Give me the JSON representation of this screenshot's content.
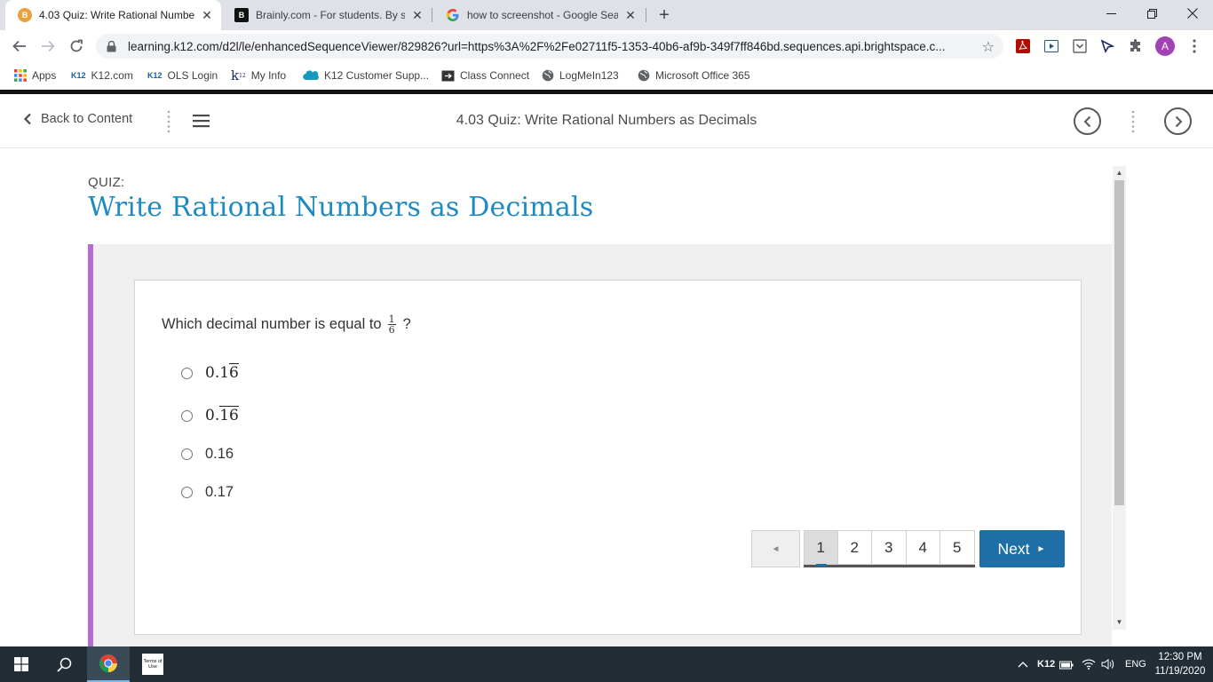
{
  "browser": {
    "tabs": [
      {
        "title": "4.03 Quiz: Write Rational Numbe",
        "favicon": "brightspace-icon",
        "active": true
      },
      {
        "title": "Brainly.com - For students. By stu",
        "favicon": "brainly-icon",
        "active": false
      },
      {
        "title": "how to screenshot - Google Sear",
        "favicon": "google-icon",
        "active": false
      }
    ],
    "url": "learning.k12.com/d2l/le/enhancedSequenceViewer/829826?url=https%3A%2F%2Fe02711f5-1353-40b6-af9b-349f7ff846bd.sequences.api.brightspace.c...",
    "profile_initial": "A",
    "bookmarks": [
      {
        "label": "Apps"
      },
      {
        "label": "K12.com"
      },
      {
        "label": "OLS Login"
      },
      {
        "label": "My Info"
      },
      {
        "label": "K12 Customer Supp..."
      },
      {
        "label": "Class Connect"
      },
      {
        "label": "LogMeIn123"
      },
      {
        "label": "Microsoft Office 365"
      }
    ],
    "bookmark_icon_text": {
      "k12": "K12",
      "myinfo": "k",
      "myinfo_sup": "12"
    }
  },
  "header": {
    "back_label": "Back to Content",
    "title": "4.03 Quiz: Write Rational Numbers as Decimals"
  },
  "quiz": {
    "label": "QUIZ:",
    "title": "Write Rational Numbers as Decimals",
    "question": {
      "text": "Which decimal number is equal to",
      "fraction_numerator": "1",
      "fraction_denominator": "6",
      "suffix": "?"
    },
    "options": [
      {
        "prefix": "0.1",
        "overline": "6",
        "plain": ""
      },
      {
        "prefix": "0.",
        "overline": "16",
        "plain": ""
      },
      {
        "prefix": "",
        "overline": "",
        "plain": "0.16"
      },
      {
        "prefix": "",
        "overline": "",
        "plain": "0.17"
      }
    ],
    "pager": {
      "prev_symbol": "◄",
      "pages": [
        "1",
        "2",
        "3",
        "4",
        "5"
      ],
      "current_page": "1",
      "next_label": "Next",
      "next_symbol": "►"
    }
  },
  "taskbar": {
    "pinned": [
      "windows-start",
      "search",
      "chrome",
      "terms-of-use"
    ],
    "terms_icon_text": "Terms of Use",
    "tray_k12": "K12",
    "language": "ENG",
    "time": "12:30 PM",
    "date": "11/19/2020"
  },
  "colors": {
    "accent_blue": "#1d8bbf",
    "next_button": "#1d6fa6",
    "panel_border_purple": "#b76bd0"
  }
}
